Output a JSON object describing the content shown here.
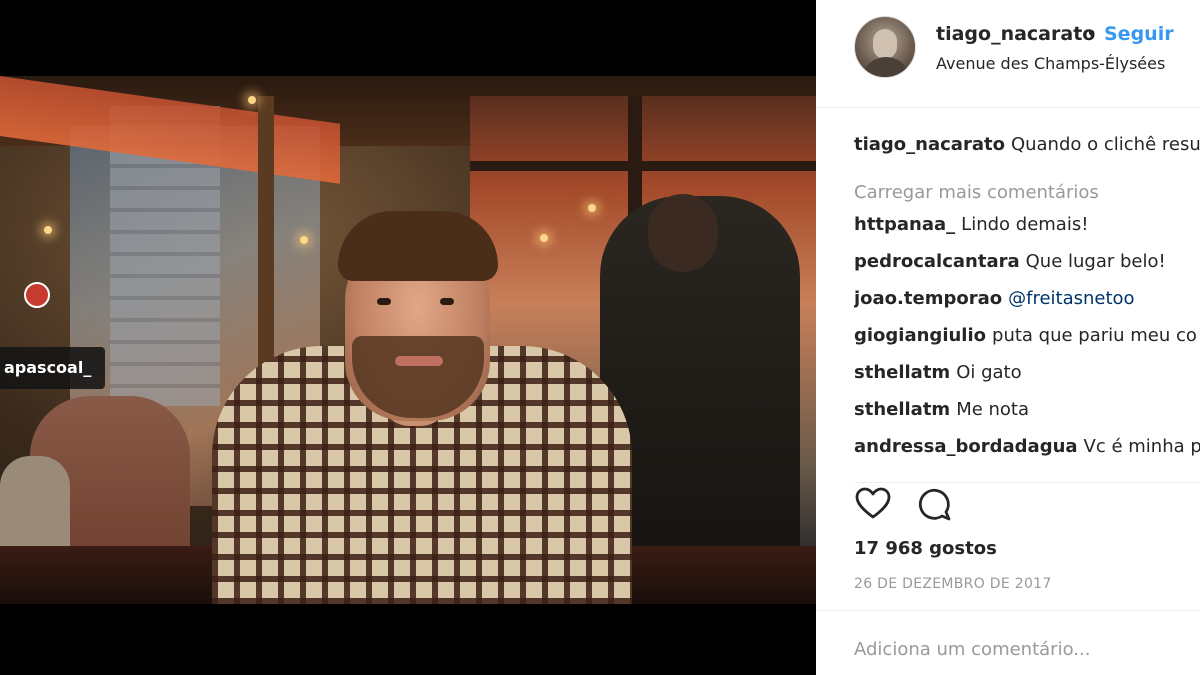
{
  "post": {
    "photo_tag": "apascoal_"
  },
  "header": {
    "username": "tiago_nacarato",
    "separator": "•",
    "follow_label": "Seguir",
    "location": "Avenue des Champs-Élysées"
  },
  "comments": {
    "caption": {
      "user": "tiago_nacarato",
      "text": "Quando o clichê resu"
    },
    "load_more": "Carregar mais comentários",
    "items": [
      {
        "user": "httpanaa_",
        "text": "Lindo demais!"
      },
      {
        "user": "pedrocalcantara",
        "text": "Que lugar belo!"
      },
      {
        "user": "joao.temporao",
        "mention": "@freitasnetoo"
      },
      {
        "user": "giogiangiulio",
        "text": "puta que pariu meu co"
      },
      {
        "user": "sthellatm",
        "text": "Oi gato"
      },
      {
        "user": "sthellatm",
        "text": "Me nota"
      },
      {
        "user": "andressa_bordadagua",
        "text": "Vc é minha p"
      }
    ]
  },
  "actions": {
    "like_icon": "heart-icon",
    "comment_icon": "comment-icon",
    "likes": "17 968 gostos",
    "date": "26 DE DEZEMBRO DE 2017"
  },
  "add_comment": {
    "placeholder": "Adiciona um comentário..."
  },
  "colors": {
    "accent": "#3897f0",
    "text": "#262626",
    "muted": "#999999"
  }
}
